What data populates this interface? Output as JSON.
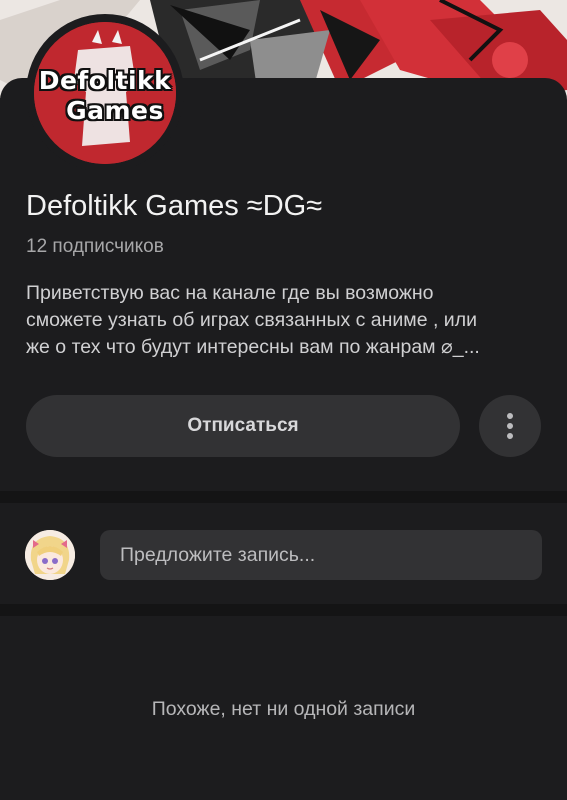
{
  "channel": {
    "logo_line1": "Defoltikk",
    "logo_line2": "Games",
    "title": "Defoltikk Games ≈DG≈",
    "subscribers": "12 подписчиков",
    "description_lines": [
      "Приветствую вас на канале где вы возможно",
      "сможете узнать об играх связанных с аниме , или",
      "же о тех что будут интересны вам по жанрам ⌀_..."
    ]
  },
  "actions": {
    "unsubscribe_label": "Отписаться",
    "more_icon": "more-vertical-icon"
  },
  "composer": {
    "placeholder": "Предложите запись..."
  },
  "feed": {
    "empty_text": "Похоже, нет ни одной записи"
  },
  "colors": {
    "background": "#1c1c1e",
    "surface": "#323234",
    "divider": "#141415",
    "avatar_red": "#c0282f"
  }
}
